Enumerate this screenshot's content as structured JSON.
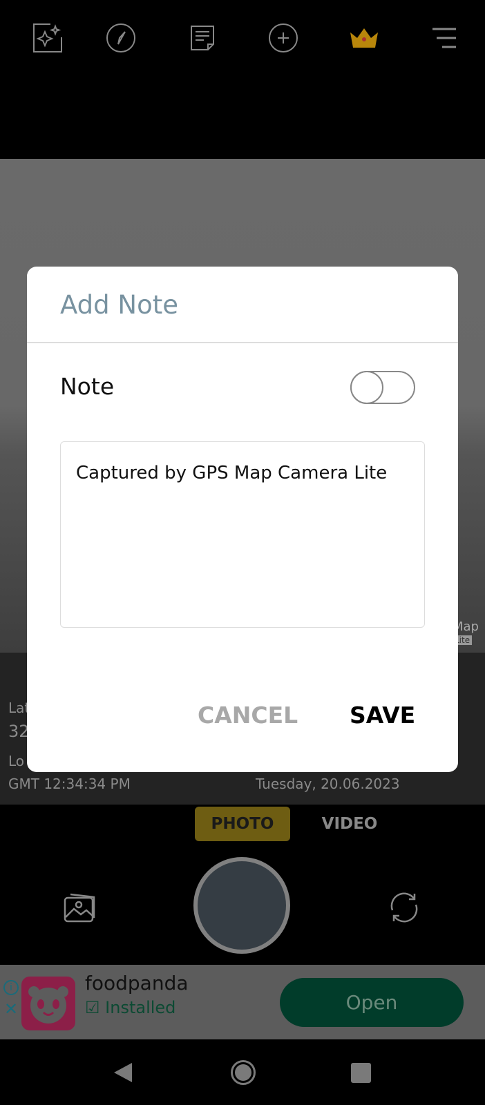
{
  "toolbar": {
    "icons": [
      "sparkle-template-icon",
      "compass-icon",
      "note-icon",
      "add-badge-icon",
      "crown-premium-icon",
      "menu-icon"
    ]
  },
  "overlay_info": {
    "lat_label": "Lat",
    "lat_value": "32",
    "long_label": "Lo",
    "time": "GMT 12:34:34 PM",
    "date": "Tuesday, 20.06.2023",
    "watermark_1": "Map",
    "watermark_2": "Lite"
  },
  "modes": {
    "photo": "PHOTO",
    "video": "VIDEO"
  },
  "ad": {
    "app_name": "foodpanda",
    "status": "Installed",
    "cta": "Open"
  },
  "dialog": {
    "title": "Add Note",
    "note_label": "Note",
    "toggle_on": false,
    "note_text": "Captured by GPS Map Camera Lite",
    "cancel": "CANCEL",
    "save": "SAVE"
  },
  "colors": {
    "title": "#7892a0",
    "photo_mode": "#6e5d12",
    "ad_button": "#013c2a",
    "crown": "#b8860b"
  }
}
